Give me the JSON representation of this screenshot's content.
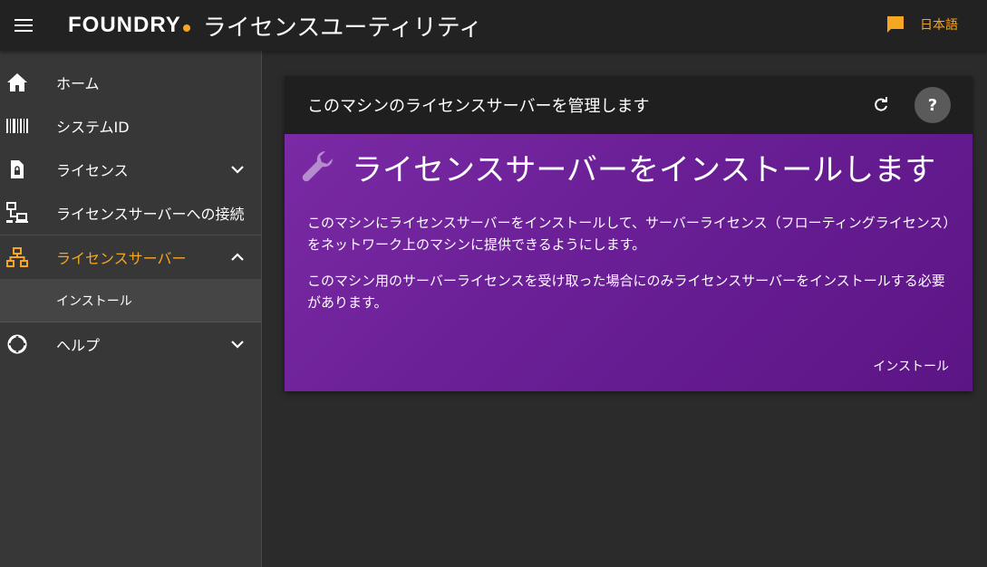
{
  "header": {
    "logo_text": "FOUNDRY",
    "title": "ライセンスユーティリティ",
    "language_label": "日本語",
    "brand_color": "#f5a623"
  },
  "sidebar": {
    "items": [
      {
        "label": "ホーム",
        "icon": "home-icon"
      },
      {
        "label": "システムID",
        "icon": "barcode-icon"
      },
      {
        "label": "ライセンス",
        "icon": "license-file-icon",
        "expandable": true
      },
      {
        "label": "ライセンスサーバーへの接続",
        "icon": "network-connect-icon"
      },
      {
        "label": "ライセンスサーバー",
        "icon": "server-tree-icon",
        "expanded": true,
        "active": true
      },
      {
        "label": "ヘルプ",
        "icon": "lifebuoy-icon",
        "expandable": true
      }
    ],
    "subitems": [
      {
        "label": "インストール"
      }
    ]
  },
  "card": {
    "header_title": "このマシンのライセンスサーバーを管理します",
    "help_label": "?",
    "hero_title": "ライセンスサーバーをインストールします",
    "paragraph1": "このマシンにライセンスサーバーをインストールして、サーバーライセンス（フローティングライセンス）をネットワーク上のマシンに提供できるようにします。",
    "paragraph2": "このマシン用のサーバーライセンスを受け取った場合にのみライセンスサーバーをインストールする必要があります。",
    "install_button": "インストール",
    "accent_color": "#6a1f96"
  }
}
